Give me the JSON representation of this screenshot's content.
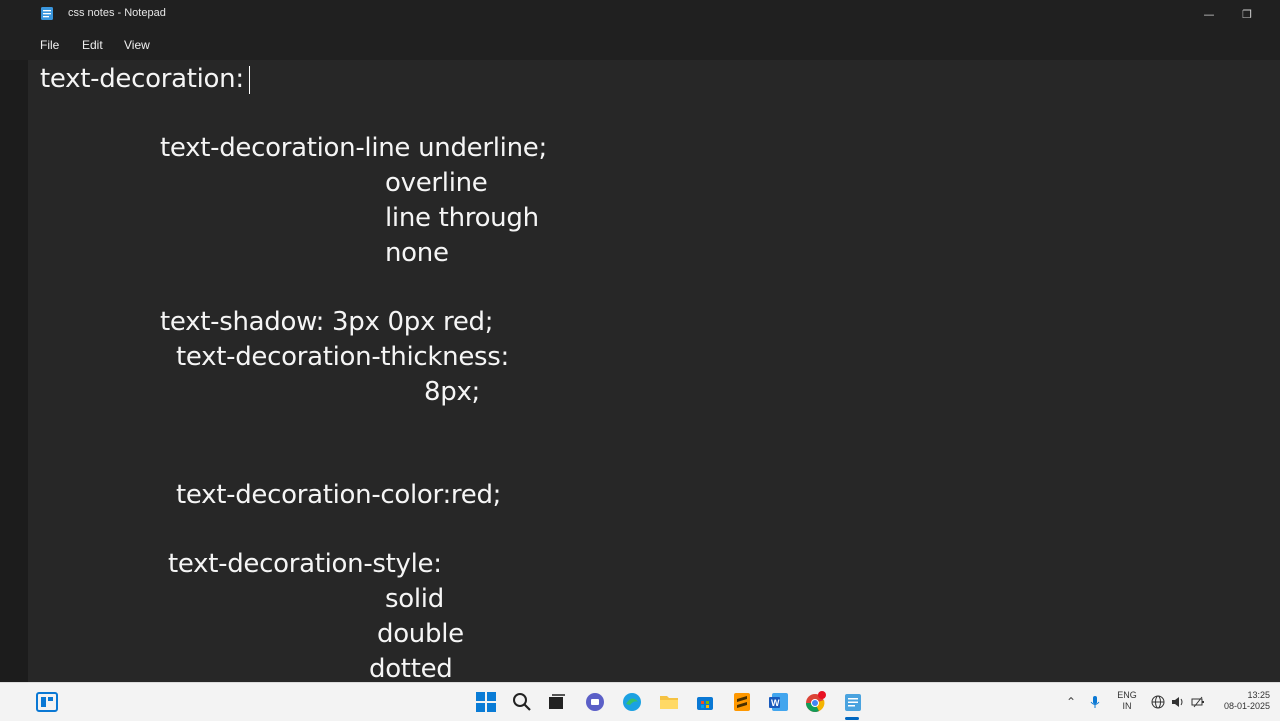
{
  "window": {
    "title": "css notes - Notepad",
    "minimize_glyph": "—",
    "restore_glyph": "❐"
  },
  "menu": {
    "file": "File",
    "edit": "Edit",
    "view": "View"
  },
  "editor": {
    "lines": [
      "text-decoration:",
      "text-decoration-line underline;",
      "overline",
      "line through",
      "none",
      "text-shadow: 3px 0px red;",
      "text-decoration-thickness:",
      "8px;",
      "text-decoration-color:red;",
      "text-decoration-style:",
      "solid",
      "double",
      "dotted"
    ]
  },
  "taskbar": {
    "icons": [
      "widgets-icon",
      "start-icon",
      "search-icon",
      "task-view-icon",
      "teams-icon",
      "edge-icon",
      "file-explorer-icon",
      "store-icon",
      "sublime-icon",
      "word-icon",
      "chrome-icon",
      "notepad-icon"
    ],
    "lang_top": "ENG",
    "lang_bottom": "IN",
    "time": "13:25",
    "date": "08-01-2025"
  },
  "colors": {
    "editor_bg": "#272727",
    "titlebar_bg": "#202020",
    "text": "#f5f5f5",
    "taskbar_bg": "#f3f3f3",
    "accent": "#0067c0"
  }
}
